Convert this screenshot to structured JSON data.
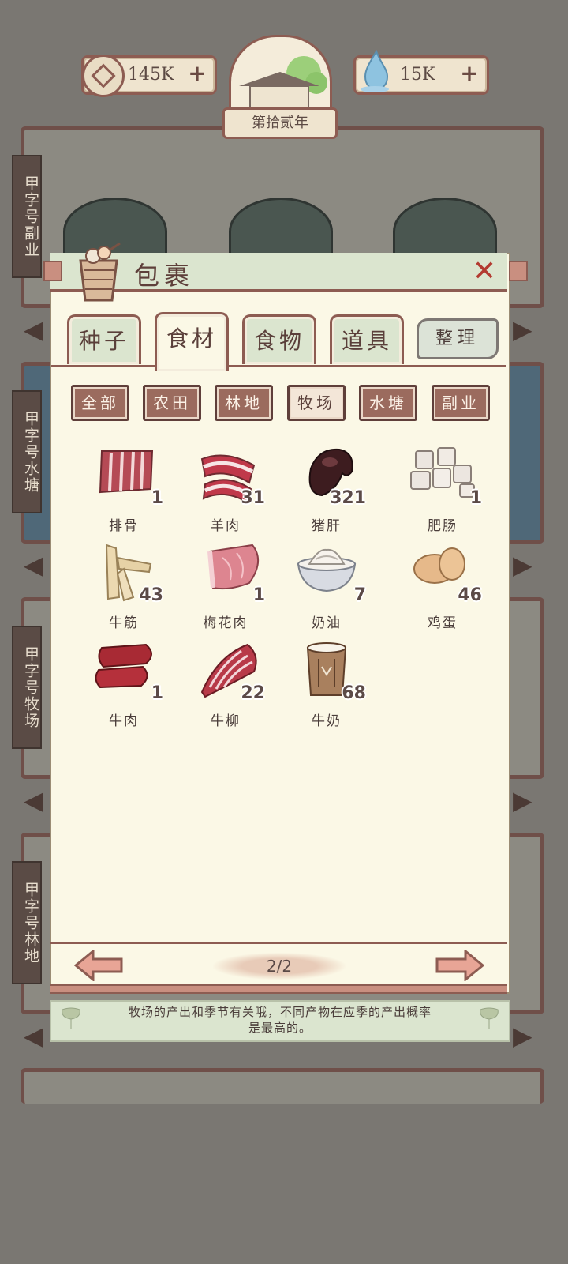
{
  "resources": {
    "coins": "145K",
    "water": "15K",
    "add_symbol": "+"
  },
  "year_label": "第拾贰年",
  "side_labels": [
    "甲字号副业",
    "甲字号水塘",
    "甲字号牧场",
    "甲字号林地"
  ],
  "panel": {
    "title": "包裹",
    "close_symbol": "✕",
    "sort_label": "整理"
  },
  "tabs": [
    {
      "label": "种子",
      "active": false
    },
    {
      "label": "食材",
      "active": true
    },
    {
      "label": "食物",
      "active": false
    },
    {
      "label": "道具",
      "active": false
    }
  ],
  "filters": [
    {
      "label": "全部",
      "active": false
    },
    {
      "label": "农田",
      "active": false
    },
    {
      "label": "林地",
      "active": false
    },
    {
      "label": "牧场",
      "active": true
    },
    {
      "label": "水塘",
      "active": false
    },
    {
      "label": "副业",
      "active": false
    }
  ],
  "items": [
    {
      "name": "排骨",
      "qty": "1",
      "icon": "ribs-icon"
    },
    {
      "name": "羊肉",
      "qty": "31",
      "icon": "mutton-icon"
    },
    {
      "name": "猪肝",
      "qty": "321",
      "icon": "pork-liver-icon"
    },
    {
      "name": "肥肠",
      "qty": "1",
      "icon": "intestine-icon"
    },
    {
      "name": "牛筋",
      "qty": "43",
      "icon": "beef-tendon-icon"
    },
    {
      "name": "梅花肉",
      "qty": "1",
      "icon": "pork-shoulder-icon"
    },
    {
      "name": "奶油",
      "qty": "7",
      "icon": "cream-icon"
    },
    {
      "name": "鸡蛋",
      "qty": "46",
      "icon": "egg-icon"
    },
    {
      "name": "牛肉",
      "qty": "1",
      "icon": "beef-icon"
    },
    {
      "name": "牛柳",
      "qty": "22",
      "icon": "beef-fillet-icon"
    },
    {
      "name": "牛奶",
      "qty": "68",
      "icon": "milk-icon"
    }
  ],
  "pager": {
    "page": "2/2"
  },
  "tip_line1": "牧场的产出和季节有关哦，不同产物在应季的产出概率",
  "tip_line2": "是最高的。"
}
